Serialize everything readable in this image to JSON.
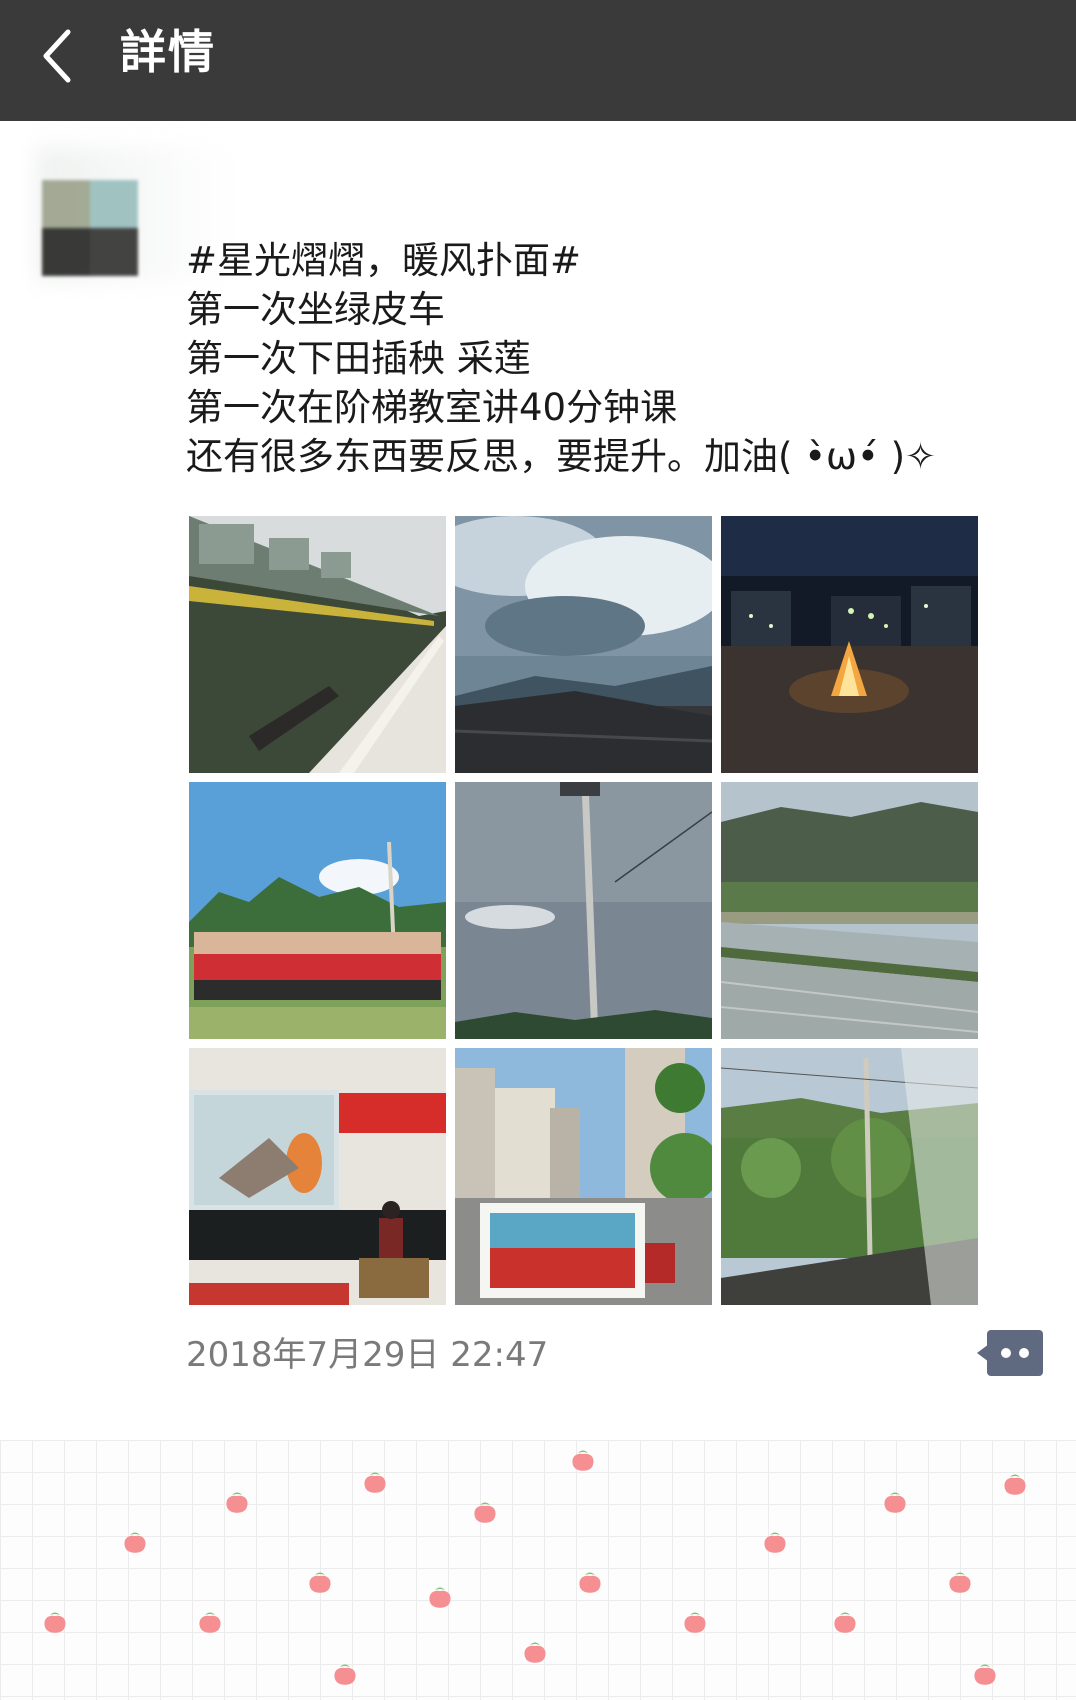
{
  "header": {
    "title": "詳情",
    "back_icon": "chevron-left-icon",
    "background": "#3a3a3a"
  },
  "post": {
    "lines": [
      "#星光熠熠，暖风扑面#",
      "第一次坐绿皮车",
      "第一次下田插秧 采莲",
      "第一次在阶梯教室讲40分钟课",
      "还有很多东西要反思，要提升。加油( •̀ω•́ )✧"
    ],
    "photos": [
      "green-train-photo",
      "cloudy-sky-rooftops-photo",
      "night-bonfire-photo",
      "group-red-shirts-mountains-photo",
      "street-lamp-sky-photo",
      "rice-fields-mountains-photo",
      "classroom-lecture-photo",
      "town-street-group-photo",
      "train-window-hills-photo"
    ],
    "timestamp": "2018年7月29日 22:47",
    "comment_icon": "comment-dots-icon"
  },
  "colors": {
    "header_bg": "#3a3a3a",
    "timestamp": "#7a7a7a",
    "comment_button": "#5f6a80"
  }
}
